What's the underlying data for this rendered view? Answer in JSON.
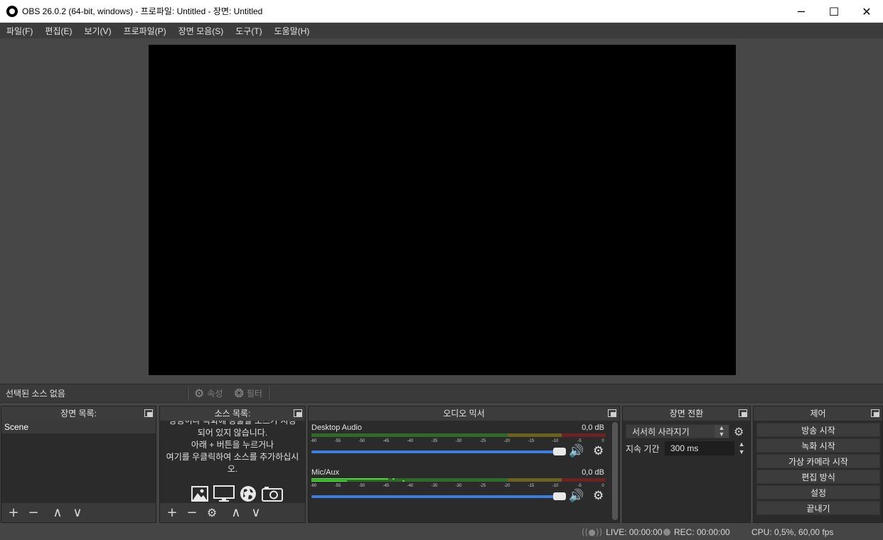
{
  "window": {
    "title": "OBS 26.0.2 (64-bit, windows) - 프로파일: Untitled - 장면: Untitled",
    "minimize": "─",
    "maximize": "☐",
    "close": "✕"
  },
  "menu": [
    {
      "label": "파일(F)"
    },
    {
      "label": "편집(E)"
    },
    {
      "label": "보기(V)"
    },
    {
      "label": "프로파일(P)"
    },
    {
      "label": "장면 모음(S)"
    },
    {
      "label": "도구(T)"
    },
    {
      "label": "도움말(H)"
    }
  ],
  "source_toolbar": {
    "no_source": "선택된 소스 없음",
    "properties": "속성",
    "filters": "필터"
  },
  "scenes": {
    "title": "장면 목록:",
    "items": [
      "Scene"
    ]
  },
  "sources": {
    "title": "소스 목록:",
    "empty_line1": "방송이나 녹화에 송출할 소스가 지정",
    "empty_line2": "되어 있지 않습니다.",
    "empty_line3": "아래 + 버튼을 누르거나",
    "empty_line4": "여기를 우클릭하여 소스를 추가하십시",
    "empty_line5": "오."
  },
  "mixer": {
    "title": "오디오 믹서",
    "ticks": [
      "-60",
      "-55",
      "-50",
      "-45",
      "-40",
      "-35",
      "-30",
      "-25",
      "-20",
      "-15",
      "-10",
      "-5",
      "0"
    ],
    "channels": [
      {
        "name": "Desktop Audio",
        "db": "0,0 dB",
        "volume": 1.0
      },
      {
        "name": "Mic/Aux",
        "db": "0,0 dB",
        "volume": 1.0
      }
    ]
  },
  "transitions": {
    "title": "장면 전환",
    "selected": "서서히 사라지기",
    "duration_label": "지속 기간",
    "duration_value": "300 ms"
  },
  "controls": {
    "title": "제어",
    "start_streaming": "방송 시작",
    "start_recording": "녹화 시작",
    "start_virtualcam": "가상 카메라 시작",
    "studio_mode": "편집 방식",
    "settings": "설정",
    "exit": "끝내기"
  },
  "status": {
    "live": "LIVE: 00:00:00",
    "rec": "REC: 00:00:00",
    "cpu": "CPU: 0,5%, 60,00 fps"
  },
  "colors": {
    "accent": "#3d7de0",
    "meter_green": "#4caf3a",
    "meter_yellow": "#a59a2b",
    "meter_red": "#a53030"
  }
}
